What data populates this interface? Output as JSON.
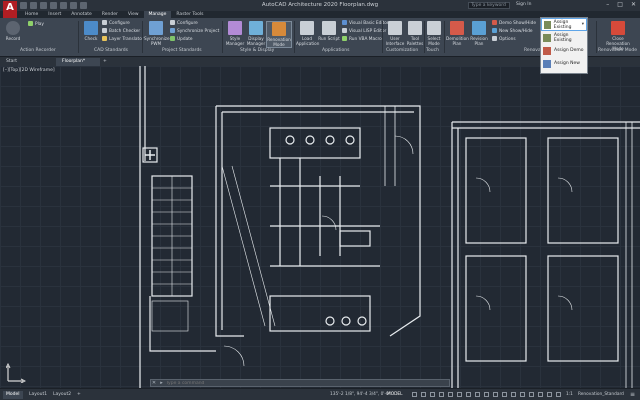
{
  "app": {
    "logo": "A",
    "title": "AutoCAD Architecture 2020   Floorplan.dwg"
  },
  "titlebar": {
    "search_placeholder": "Type a keyword",
    "signin_text": "Sign In",
    "window_buttons": [
      "–",
      "□",
      "✕"
    ]
  },
  "ribbon_tabs": [
    "Home",
    "Insert",
    "Annotate",
    "Render",
    "View",
    "Manage",
    "Raster Tools"
  ],
  "active_tab": "Manage",
  "ribbon": {
    "record": "Record",
    "play": "Play",
    "check": "Check",
    "configure": "Configure",
    "batch_checker": "Batch Checker",
    "layer_translator": "Layer Translator",
    "synchronize": "Synchronize",
    "pwm": "PWM",
    "configure2": "Configure",
    "synchronize_project": "Synchronize Project",
    "update": "Update",
    "style_manager": "Style Manager",
    "display_manager": "Display Manager",
    "renovation_mode": "Renovation Mode",
    "load_application": "Load Application",
    "run_script": "Run Script",
    "visual_basic_editor": "Visual Basic Editor",
    "visual_lisp_editor": "Visual LISP Editor",
    "run_vba_macro": "Run VBA Macro",
    "user_interface": "User Interface",
    "tool_palettes": "Tool Palettes",
    "select_mode": "Select Mode",
    "demolition_plan": "Demolition Plan",
    "revision_plan": "Revision Plan",
    "demo_show_hide": "Demo Show/Hide",
    "new_show_hide": "New Show/Hide",
    "options": "Options",
    "assign_existing": "Assign Existing",
    "close_renovation_mode": "Close Renovation Mode"
  },
  "panel_titles": {
    "action_recorder": "Action Recorder",
    "cad_standards": "CAD Standards",
    "project_standards": "Project Standards",
    "style_display": "Style & Display",
    "applications": "Applications",
    "customization": "Customization",
    "touch": "Touch",
    "renovation": "Renova",
    "renovation_mode": "Renovation Mode"
  },
  "dropdown": {
    "items": [
      "Assign Existing",
      "Assign Demo",
      "Assign New"
    ],
    "selected": "Assign Existing"
  },
  "doc_tabs": {
    "start": "Start",
    "file": "Floorplan*",
    "plus": "+"
  },
  "viewport_label": "[–][Top][2D Wireframe]",
  "command_line": {
    "close": "✕",
    "icon": "▸",
    "placeholder": "Type a command"
  },
  "status_bar": {
    "layouts": [
      "Model",
      "Layout1",
      "Layout2"
    ],
    "add_layout": "+",
    "coordinates": "135'-2 1/8\", 94'-4 3/4\", 0'-0\"",
    "model_label": "MODEL",
    "scale": "1:1",
    "style": "Renovation_Standard",
    "menu_icon": "≡"
  },
  "colors": {
    "accent_red": "#b01e23",
    "ribbon_bg": "#3d4652",
    "canvas_bg": "#222933",
    "linework": "#e8ecef",
    "dropdown_selection": "#5fa5e8"
  },
  "icons": {
    "app_logo": "autocad-a-logo",
    "ucs": "ucs-icon",
    "renovation_mode": "renovation-mode-icon"
  }
}
